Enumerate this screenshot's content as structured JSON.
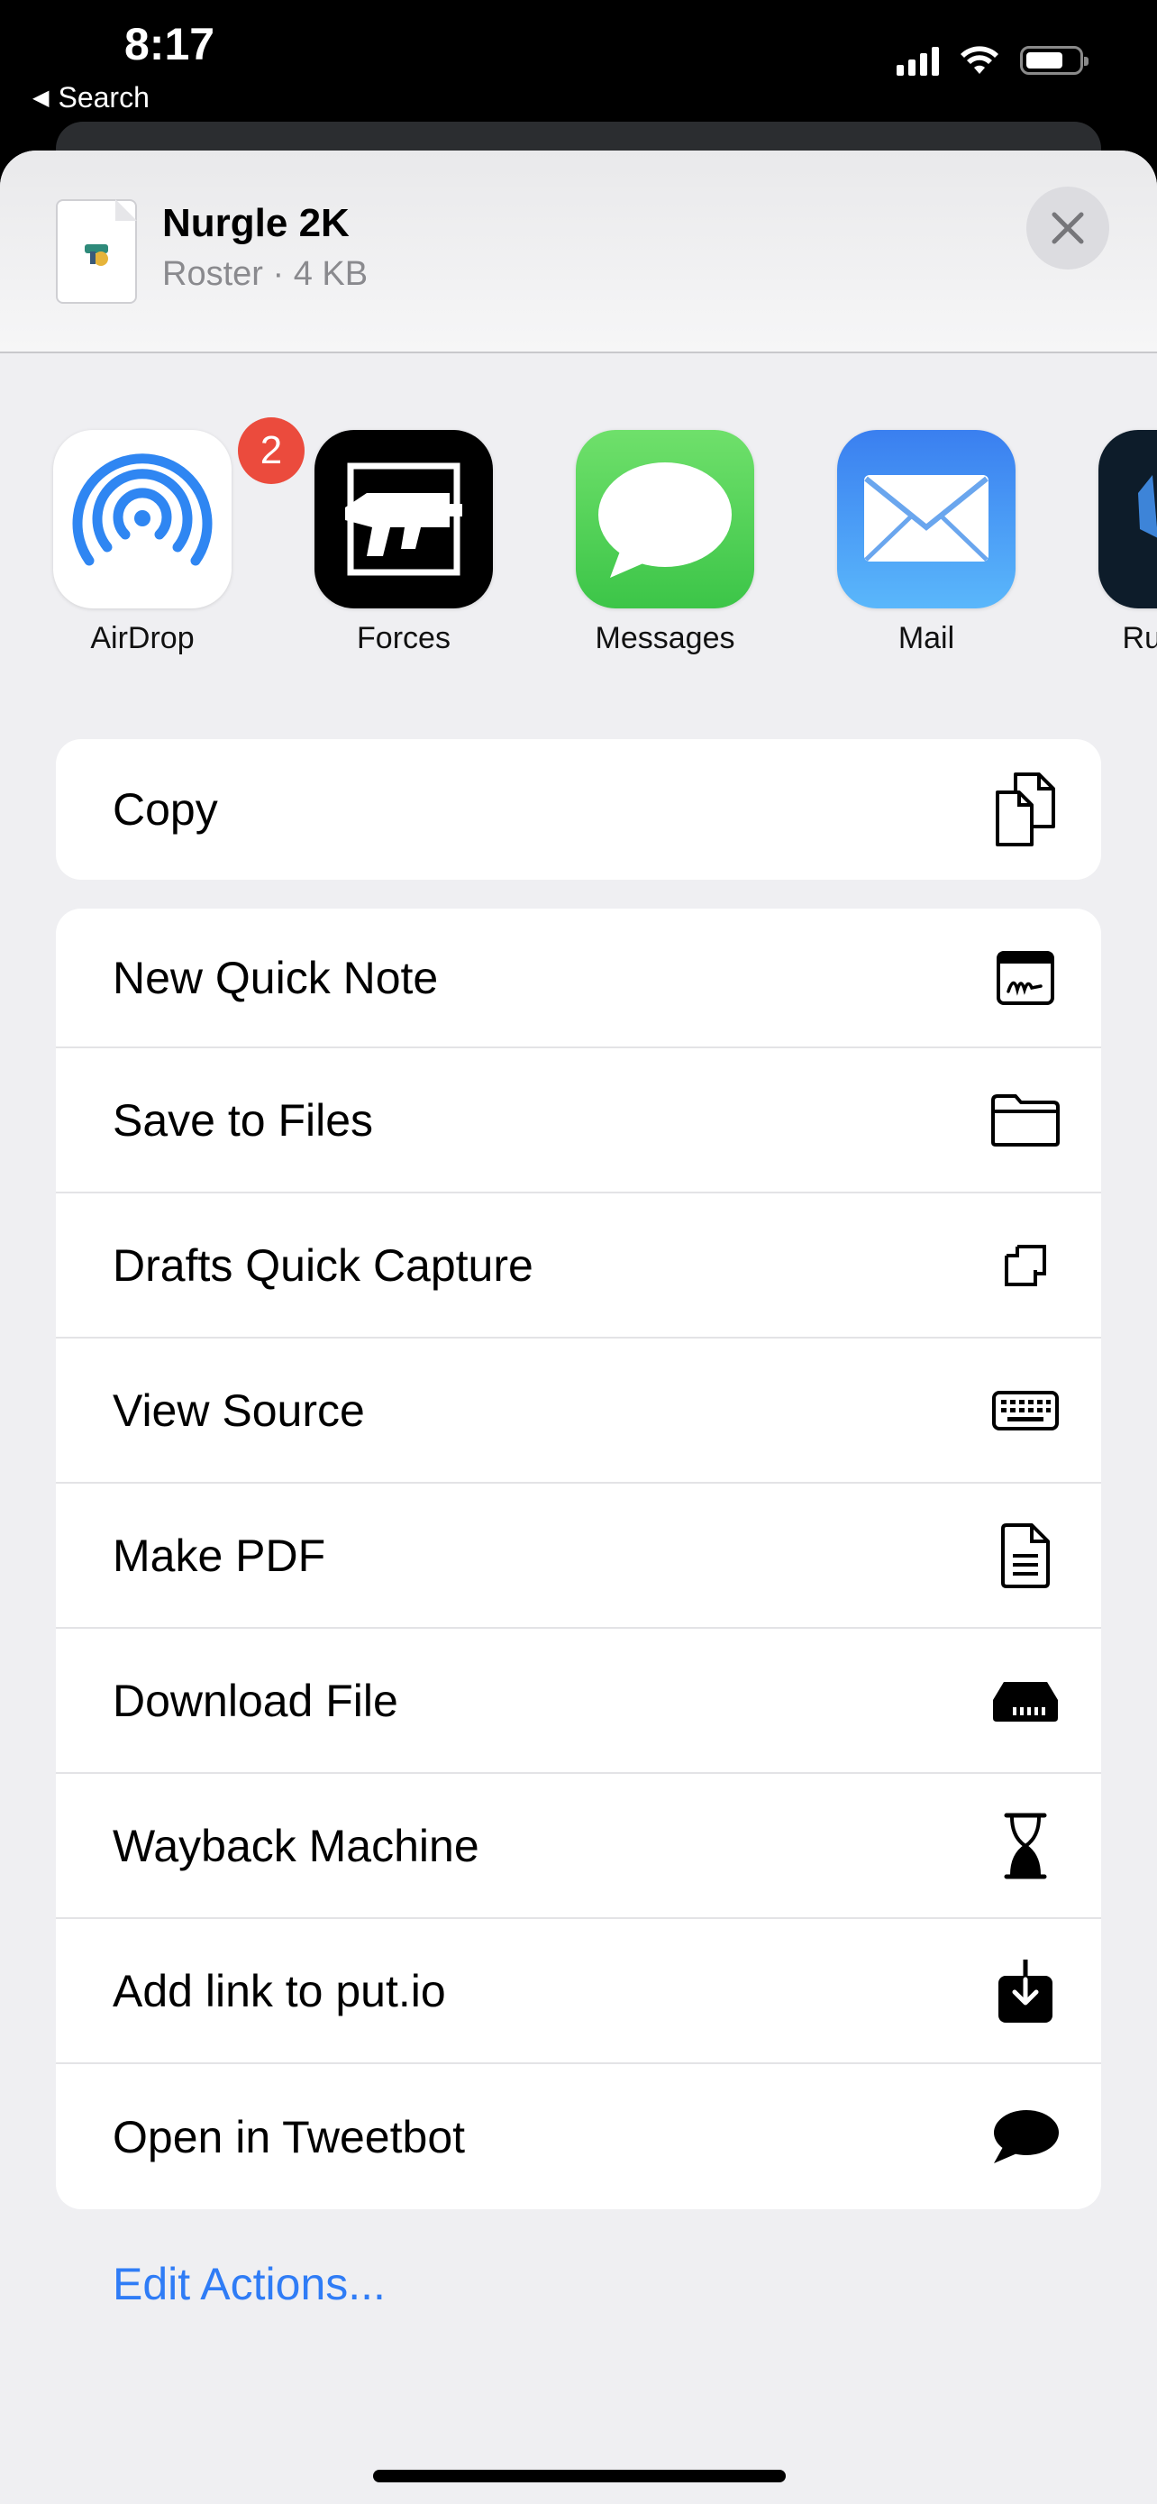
{
  "status_bar": {
    "time": "8:17",
    "back_label": "Search"
  },
  "share_sheet": {
    "file": {
      "name": "Nurgle 2K",
      "meta": "Roster · 4 KB"
    }
  },
  "apps": [
    {
      "label": "AirDrop",
      "icon": "airdrop-icon",
      "badge": "2"
    },
    {
      "label": "Forces",
      "icon": "forces-icon"
    },
    {
      "label": "Messages",
      "icon": "messages-icon"
    },
    {
      "label": "Mail",
      "icon": "mail-icon"
    },
    {
      "label": "Runestaff",
      "icon": "runestaff-icon"
    }
  ],
  "actions_primary": [
    {
      "label": "Copy",
      "icon": "copy-icon"
    }
  ],
  "actions": [
    {
      "label": "New Quick Note",
      "icon": "quick-note-icon"
    },
    {
      "label": "Save to Files",
      "icon": "folder-icon"
    },
    {
      "label": "Drafts Quick Capture",
      "icon": "drafts-icon"
    },
    {
      "label": "View Source",
      "icon": "keyboard-icon"
    },
    {
      "label": "Make PDF",
      "icon": "document-icon"
    },
    {
      "label": "Download File",
      "icon": "download-drive-icon"
    },
    {
      "label": "Wayback Machine",
      "icon": "hourglass-icon"
    },
    {
      "label": "Add link to put.io",
      "icon": "tray-download-icon"
    },
    {
      "label": "Open in Tweetbot",
      "icon": "speech-bubble-icon"
    }
  ],
  "edit_actions": "Edit Actions...",
  "colors": {
    "accent": "#2f7cf6",
    "badge": "#eb4b3d",
    "messages": "#53d25a",
    "mail": "#3b8ff5"
  }
}
